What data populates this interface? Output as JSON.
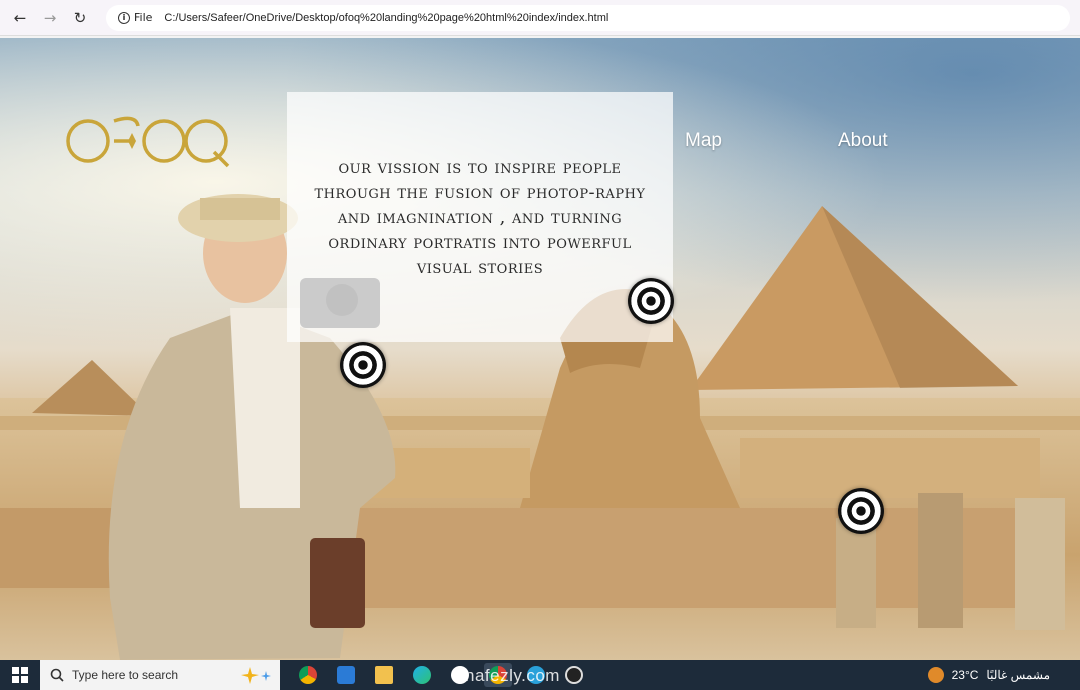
{
  "browser": {
    "file_label": "File",
    "url": "C:/Users/Safeer/OneDrive/Desktop/ofoq%20landing%20page%20html%20index/index.html"
  },
  "site": {
    "logo_text": "OFOQ",
    "nav": {
      "map": "Map",
      "about": "About"
    },
    "vision": "Our vission is to inspire people through the fusion of photop-raphy and imagnination , and turning ordinary portratis into powerful visual stories",
    "accent_gold": "#c9a53a"
  },
  "taskbar": {
    "search_placeholder": "Type here to search",
    "weather": "23°C",
    "weather_text": "مشمس غالبًا",
    "watermark": "nafezly.com"
  }
}
